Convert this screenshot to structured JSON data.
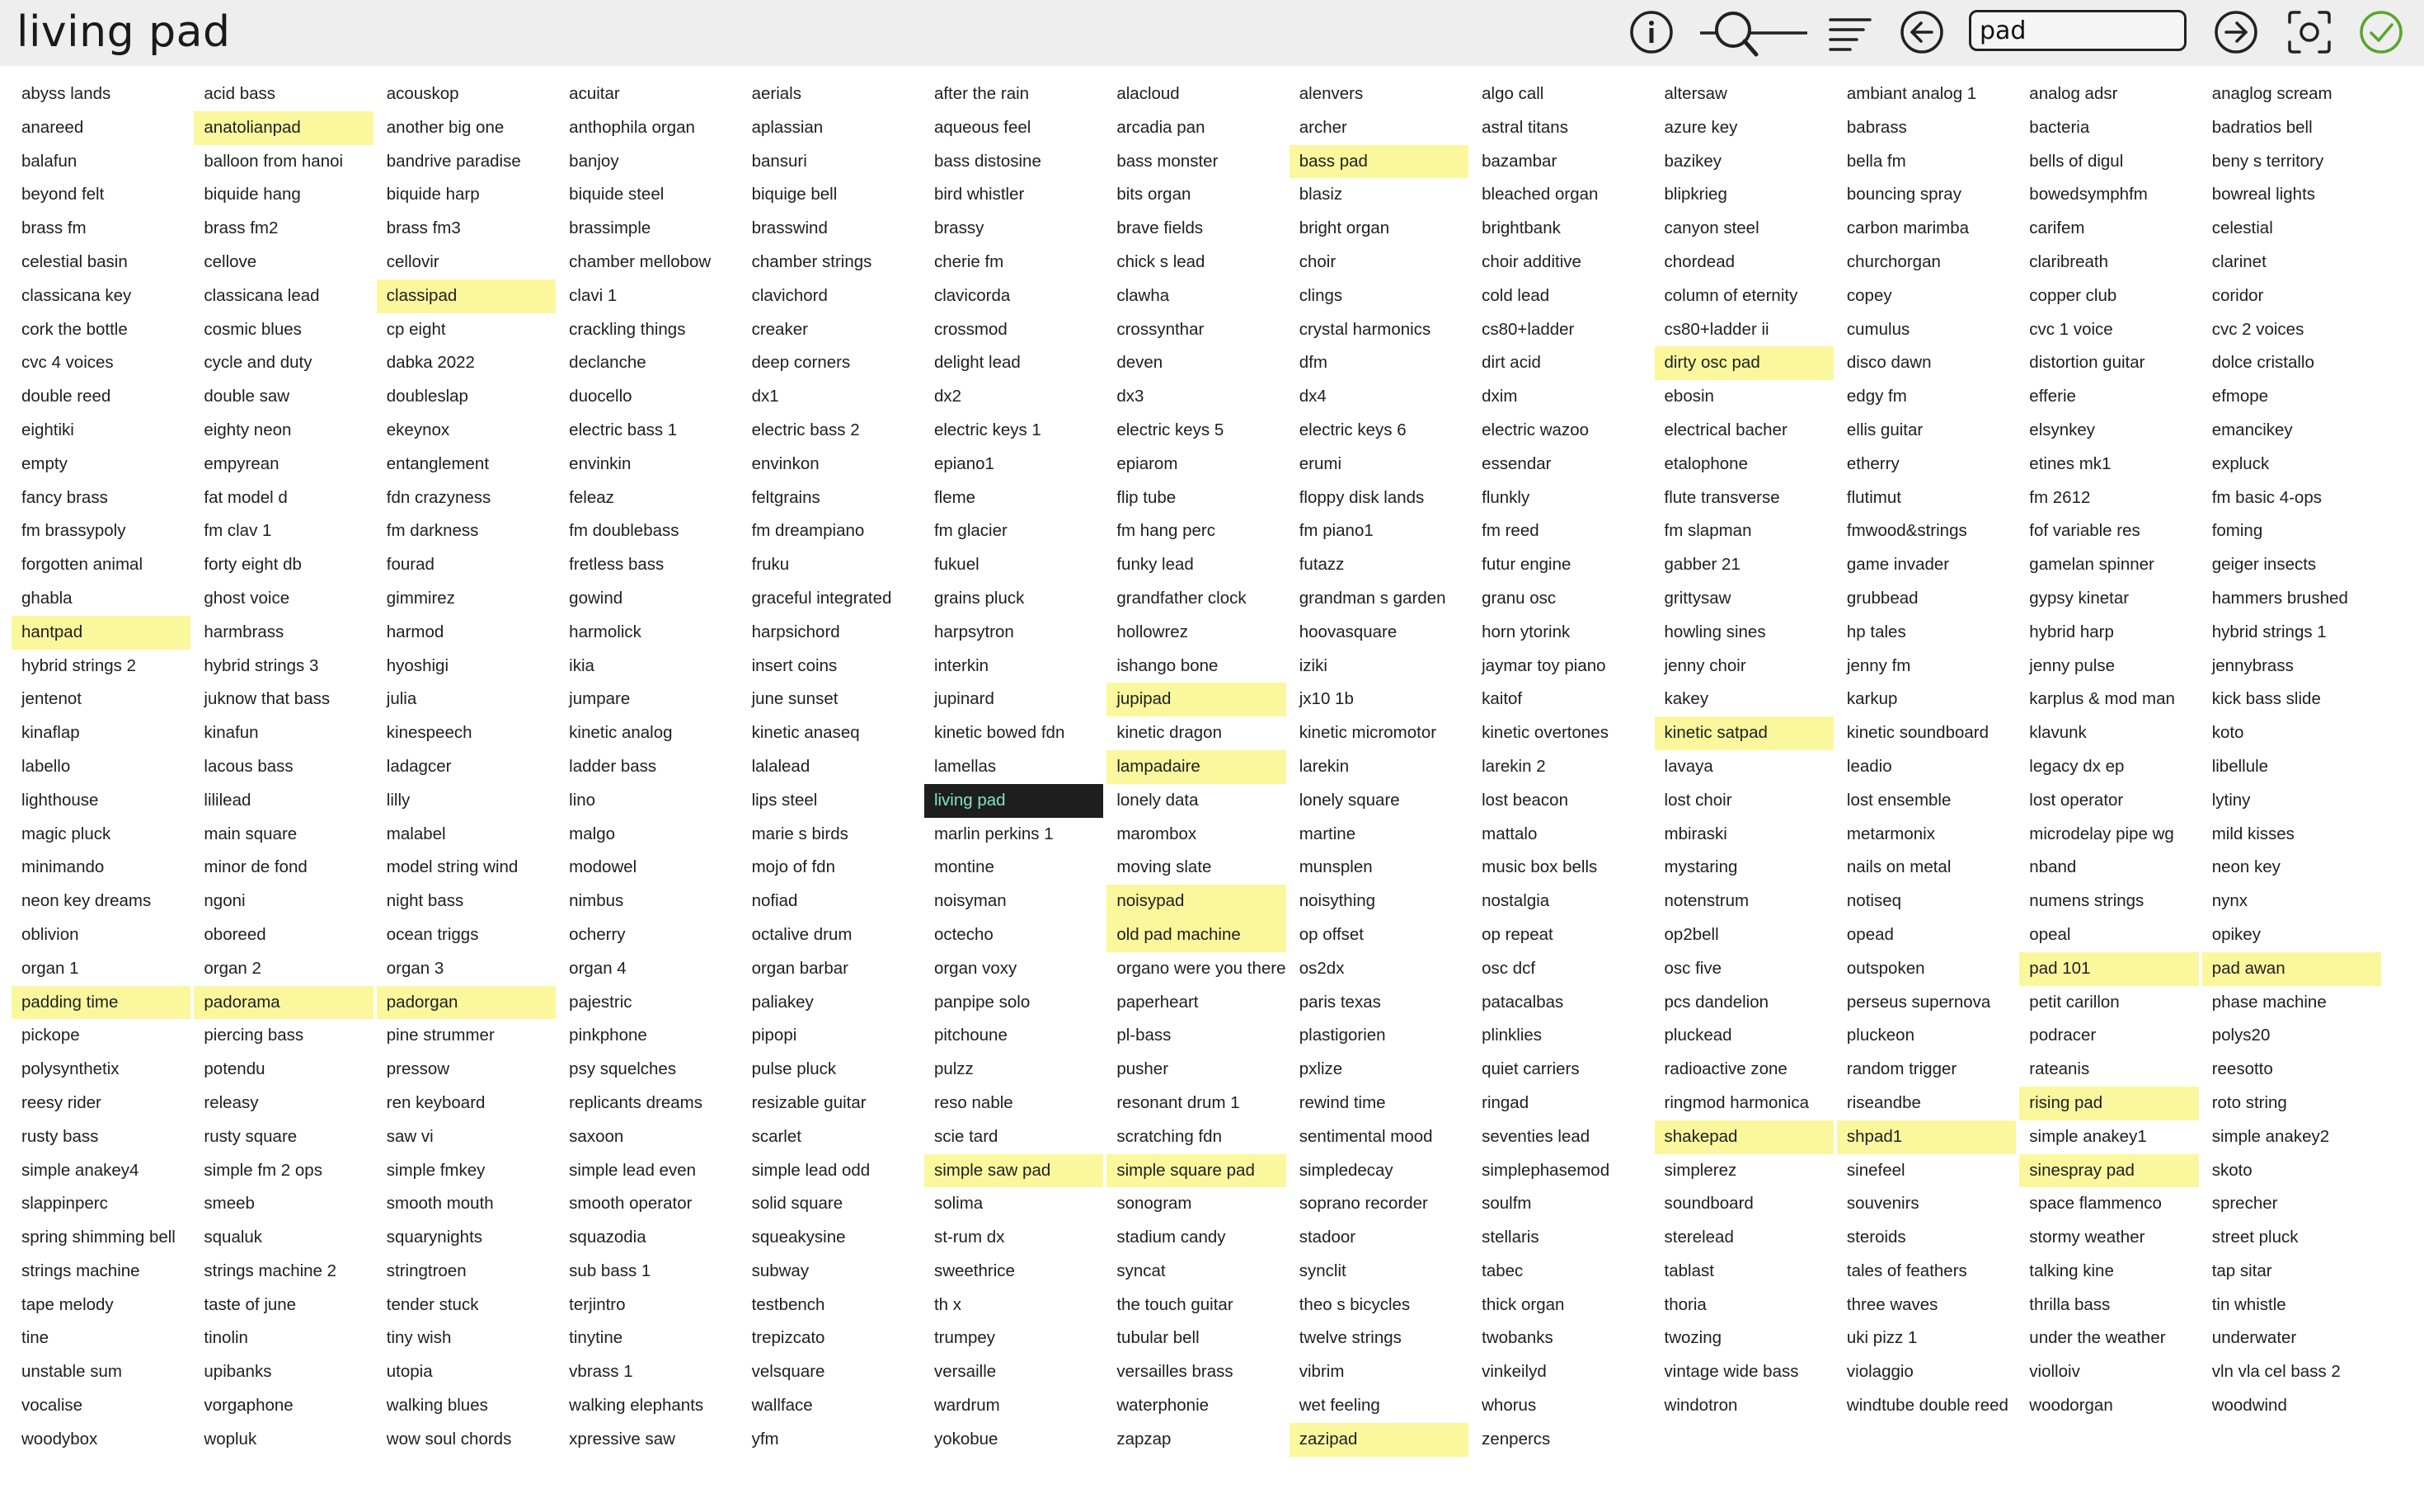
{
  "title": "living pad",
  "search": {
    "value": "pad"
  },
  "toolbar_icons": [
    "info-icon",
    "zoom-slider",
    "sort-icon",
    "back-arrow-icon",
    "forward-arrow-icon",
    "screenshot-icon",
    "confirm-check-icon"
  ],
  "colors": {
    "match_highlight": "#fbf79d",
    "current_bg": "#1e1e1e",
    "current_text": "#7fe3c6",
    "confirm": "#5aa52a"
  },
  "current_preset": "living pad",
  "highlighted_presets": [
    "anatolianpad",
    "bass pad",
    "classipad",
    "dirty osc pad",
    "hantpad",
    "jupipad",
    "kinetic satpad",
    "lampadaire",
    "noisypad",
    "old pad machine",
    "pad 101",
    "pad awan",
    "padding time",
    "padorama",
    "padorgan",
    "rising pad",
    "shakepad",
    "shpad1",
    "simple saw pad",
    "simple square pad",
    "sinespray pad",
    "zazipad"
  ],
  "presets": [
    "abyss lands",
    "acid bass",
    "acouskop",
    "acuitar",
    "aerials",
    "after the rain",
    "alacloud",
    "alenvers",
    "algo call",
    "altersaw",
    "ambiant analog 1",
    "analog adsr",
    "anaglog scream",
    "anareed",
    "anatolianpad",
    "another big one",
    "anthophila organ",
    "aplassian",
    "aqueous feel",
    "arcadia pan",
    "archer",
    "astral titans",
    "azure key",
    "babrass",
    "bacteria",
    "badratios bell",
    "balafun",
    "balloon from hanoi",
    "bandrive paradise",
    "banjoy",
    "bansuri",
    "bass distosine",
    "bass monster",
    "bass pad",
    "bazambar",
    "bazikey",
    "bella fm",
    "bells of digul",
    "beny s territory",
    "beyond felt",
    "biquide hang",
    "biquide harp",
    "biquide steel",
    "biquige bell",
    "bird whistler",
    "bits organ",
    "blasiz",
    "bleached organ",
    "blipkrieg",
    "bouncing spray",
    "bowedsymphfm",
    "bowreal lights",
    "brass fm",
    "brass fm2",
    "brass fm3",
    "brassimple",
    "brasswind",
    "brassy",
    "brave fields",
    "bright organ",
    "brightbank",
    "canyon steel",
    "carbon marimba",
    "carifem",
    "celestial",
    "celestial basin",
    "cellove",
    "cellovir",
    "chamber mellobow",
    "chamber strings",
    "cherie fm",
    "chick s lead",
    "choir",
    "choir additive",
    "chordead",
    "churchorgan",
    "claribreath",
    "clarinet",
    "classicana key",
    "classicana lead",
    "classipad",
    "clavi 1",
    "clavichord",
    "clavicorda",
    "clawha",
    "clings",
    "cold lead",
    "column of eternity",
    "copey",
    "copper club",
    "coridor",
    "cork the bottle",
    "cosmic blues",
    "cp eight",
    "crackling things",
    "creaker",
    "crossmod",
    "crossynthar",
    "crystal harmonics",
    "cs80+ladder",
    "cs80+ladder ii",
    "cumulus",
    "cvc 1 voice",
    "cvc 2 voices",
    "cvc 4 voices",
    "cycle and duty",
    "dabka 2022",
    "declanche",
    "deep corners",
    "delight lead",
    "deven",
    "dfm",
    "dirt acid",
    "dirty osc pad",
    "disco dawn",
    "distortion guitar",
    "dolce cristallo",
    "double reed",
    "double saw",
    "doubleslap",
    "duocello",
    "dx1",
    "dx2",
    "dx3",
    "dx4",
    "dxim",
    "ebosin",
    "edgy fm",
    "efferie",
    "efmope",
    "eightiki",
    "eighty neon",
    "ekeynox",
    "electric bass 1",
    "electric bass 2",
    "electric keys 1",
    "electric keys 5",
    "electric keys 6",
    "electric wazoo",
    "electrical bacher",
    "ellis guitar",
    "elsynkey",
    "emancikey",
    "empty",
    "empyrean",
    "entanglement",
    "envinkin",
    "envinkon",
    "epiano1",
    "epiarom",
    "erumi",
    "essendar",
    "etalophone",
    "etherry",
    "etines mk1",
    "expluck",
    "fancy brass",
    "fat model d",
    "fdn crazyness",
    "feleaz",
    "feltgrains",
    "fleme",
    "flip tube",
    "floppy disk lands",
    "flunkly",
    "flute transverse",
    "flutimut",
    "fm 2612",
    "fm basic 4-ops",
    "fm brassypoly",
    "fm clav 1",
    "fm darkness",
    "fm doublebass",
    "fm dreampiano",
    "fm glacier",
    "fm hang perc",
    "fm piano1",
    "fm reed",
    "fm slapman",
    "fmwood&strings",
    "fof variable res",
    "foming",
    "forgotten animal",
    "forty eight db",
    "fourad",
    "fretless bass",
    "fruku",
    "fukuel",
    "funky lead",
    "futazz",
    "futur engine",
    "gabber 21",
    "game invader",
    "gamelan spinner",
    "geiger insects",
    "ghabla",
    "ghost voice",
    "gimmirez",
    "gowind",
    "graceful integrated",
    "grains pluck",
    "grandfather clock",
    "grandman s garden",
    "granu osc",
    "grittysaw",
    "grubbead",
    "gypsy kinetar",
    "hammers brushed",
    "hantpad",
    "harmbrass",
    "harmod",
    "harmolick",
    "harpsichord",
    "harpsytron",
    "hollowrez",
    "hoovasquare",
    "horn ytorink",
    "howling sines",
    "hp tales",
    "hybrid harp",
    "hybrid strings 1",
    "hybrid strings 2",
    "hybrid strings 3",
    "hyoshigi",
    "ikia",
    "insert coins",
    "interkin",
    "ishango bone",
    "iziki",
    "jaymar toy piano",
    "jenny choir",
    "jenny fm",
    "jenny pulse",
    "jennybrass",
    "jentenot",
    "juknow that bass",
    "julia",
    "jumpare",
    "june sunset",
    "jupinard",
    "jupipad",
    "jx10 1b",
    "kaitof",
    "kakey",
    "karkup",
    "karplus & mod man",
    "kick bass slide",
    "kinaflap",
    "kinafun",
    "kinespeech",
    "kinetic analog",
    "kinetic anaseq",
    "kinetic bowed fdn",
    "kinetic dragon",
    "kinetic micromotor",
    "kinetic overtones",
    "kinetic satpad",
    "kinetic soundboard",
    "klavunk",
    "koto",
    "labello",
    "lacous bass",
    "ladagcer",
    "ladder bass",
    "lalalead",
    "lamellas",
    "lampadaire",
    "larekin",
    "larekin 2",
    "lavaya",
    "leadio",
    "legacy dx ep",
    "libellule",
    "lighthouse",
    "lililead",
    "lilly",
    "lino",
    "lips steel",
    "living pad",
    "lonely data",
    "lonely square",
    "lost beacon",
    "lost choir",
    "lost ensemble",
    "lost operator",
    "lytiny",
    "magic pluck",
    "main square",
    "malabel",
    "malgo",
    "marie s birds",
    "marlin perkins 1",
    "marombox",
    "martine",
    "mattalo",
    "mbiraski",
    "metarmonix",
    "microdelay pipe wg",
    "mild kisses",
    "minimando",
    "minor de fond",
    "model string wind",
    "modowel",
    "mojo of fdn",
    "montine",
    "moving slate",
    "munsplen",
    "music box bells",
    "mystaring",
    "nails on metal",
    "nband",
    "neon key",
    "neon key dreams",
    "ngoni",
    "night bass",
    "nimbus",
    "nofiad",
    "noisyman",
    "noisypad",
    "noisything",
    "nostalgia",
    "notenstrum",
    "notiseq",
    "numens strings",
    "nynx",
    "oblivion",
    "oboreed",
    "ocean triggs",
    "ocherry",
    "octalive drum",
    "octecho",
    "old pad machine",
    "op offset",
    "op repeat",
    "op2bell",
    "opead",
    "opeal",
    "opikey",
    "organ 1",
    "organ 2",
    "organ 3",
    "organ 4",
    "organ barbar",
    "organ voxy",
    "organo were you there",
    "os2dx",
    "osc dcf",
    "osc five",
    "outspoken",
    "pad 101",
    "pad awan",
    "padding time",
    "padorama",
    "padorgan",
    "pajestric",
    "paliakey",
    "panpipe solo",
    "paperheart",
    "paris texas",
    "patacalbas",
    "pcs dandelion",
    "perseus supernova",
    "petit carillon",
    "phase machine",
    "pickope",
    "piercing bass",
    "pine strummer",
    "pinkphone",
    "pipopi",
    "pitchoune",
    "pl-bass",
    "plastigorien",
    "plinklies",
    "pluckead",
    "pluckeon",
    "podracer",
    "polys20",
    "polysynthetix",
    "potendu",
    "pressow",
    "psy squelches",
    "pulse pluck",
    "pulzz",
    "pusher",
    "pxlize",
    "quiet carriers",
    "radioactive zone",
    "random trigger",
    "rateanis",
    "reesotto",
    "reesy rider",
    "releasy",
    "ren keyboard",
    "replicants dreams",
    "resizable guitar",
    "reso nable",
    "resonant drum 1",
    "rewind time",
    "ringad",
    "ringmod harmonica",
    "riseandbe",
    "rising pad",
    "roto string",
    "rusty bass",
    "rusty square",
    "saw vi",
    "saxoon",
    "scarlet",
    "scie tard",
    "scratching fdn",
    "sentimental mood",
    "seventies lead",
    "shakepad",
    "shpad1",
    "simple anakey1",
    "simple anakey2",
    "simple anakey4",
    "simple fm 2 ops",
    "simple fmkey",
    "simple lead even",
    "simple lead odd",
    "simple saw pad",
    "simple square pad",
    "simpledecay",
    "simplephasemod",
    "simplerez",
    "sinefeel",
    "sinespray pad",
    "skoto",
    "slappinperc",
    "smeeb",
    "smooth mouth",
    "smooth operator",
    "solid square",
    "solima",
    "sonogram",
    "soprano recorder",
    "soulfm",
    "soundboard",
    "souvenirs",
    "space flammenco",
    "sprecher",
    "spring shimming bell",
    "squaluk",
    "squarynights",
    "squazodia",
    "squeakysine",
    "st-rum dx",
    "stadium candy",
    "stadoor",
    "stellaris",
    "sterelead",
    "steroids",
    "stormy weather",
    "street pluck",
    "strings machine",
    "strings machine 2",
    "stringtroen",
    "sub bass 1",
    "subway",
    "sweethrice",
    "syncat",
    "synclit",
    "tabec",
    "tablast",
    "tales of feathers",
    "talking kine",
    "tap sitar",
    "tape melody",
    "taste of june",
    "tender stuck",
    "terjintro",
    "testbench",
    "th x",
    "the touch guitar",
    "theo s bicycles",
    "thick organ",
    "thoria",
    "three waves",
    "thrilla bass",
    "tin whistle",
    "tine",
    "tinolin",
    "tiny wish",
    "tinytine",
    "trepizcato",
    "trumpey",
    "tubular bell",
    "twelve strings",
    "twobanks",
    "twozing",
    "uki pizz 1",
    "under the weather",
    "underwater",
    "unstable sum",
    "upibanks",
    "utopia",
    "vbrass 1",
    "velsquare",
    "versaille",
    "versailles brass",
    "vibrim",
    "vinkeilyd",
    "vintage wide bass",
    "violaggio",
    "violloiv",
    "vln vla cel bass 2",
    "vocalise",
    "vorgaphone",
    "walking blues",
    "walking elephants",
    "wallface",
    "wardrum",
    "waterphonie",
    "wet feeling",
    "whorus",
    "windotron",
    "windtube double reed",
    "woodorgan",
    "woodwind",
    "woodybox",
    "wopluk",
    "wow soul chords",
    "xpressive saw",
    "yfm",
    "yokobue",
    "zapzap",
    "zazipad",
    "zenpercs"
  ]
}
